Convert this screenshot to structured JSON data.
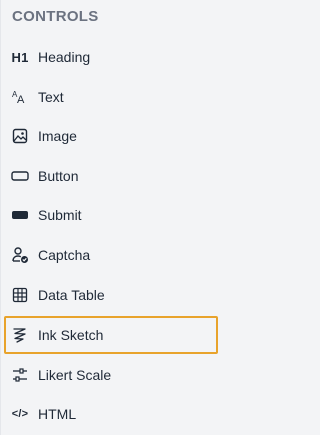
{
  "section": {
    "title": "CONTROLS"
  },
  "controls": [
    {
      "label": "Heading",
      "icon": "h1-icon",
      "glyph": "H1"
    },
    {
      "label": "Text",
      "icon": "text-icon"
    },
    {
      "label": "Image",
      "icon": "image-icon"
    },
    {
      "label": "Button",
      "icon": "button-icon"
    },
    {
      "label": "Submit",
      "icon": "submit-icon"
    },
    {
      "label": "Captcha",
      "icon": "captcha-icon"
    },
    {
      "label": "Data Table",
      "icon": "table-icon"
    },
    {
      "label": "Ink Sketch",
      "icon": "ink-sketch-icon",
      "selected": true
    },
    {
      "label": "Likert Scale",
      "icon": "sliders-icon"
    },
    {
      "label": "HTML",
      "icon": "code-icon",
      "glyph": "</>"
    }
  ],
  "colors": {
    "background": "#f3f4f6",
    "selection_border": "#e8a32c",
    "title": "#6b7280",
    "text": "#1f2937"
  }
}
